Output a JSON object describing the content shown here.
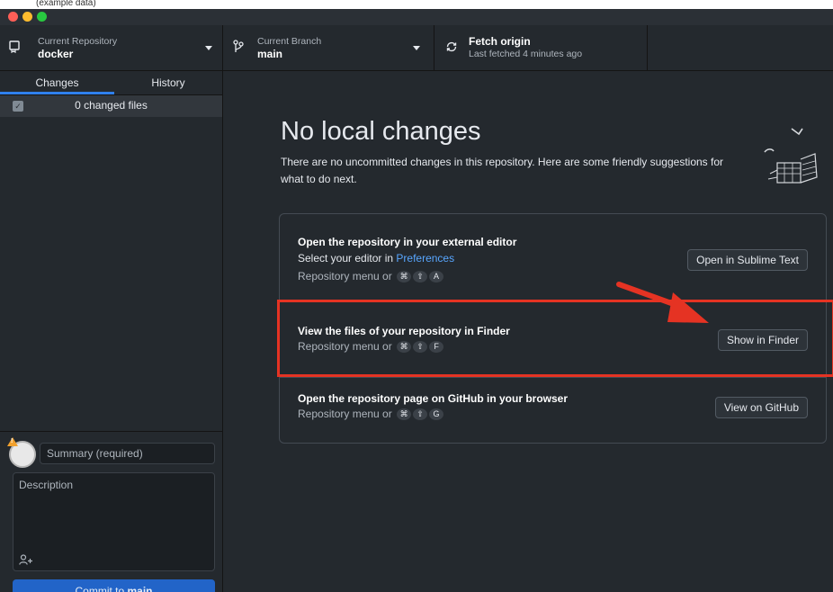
{
  "top_strip_text": "(example data)",
  "toolbar": {
    "repo": {
      "label": "Current Repository",
      "value": "docker"
    },
    "branch": {
      "label": "Current Branch",
      "value": "main"
    },
    "fetch": {
      "label": "Fetch origin",
      "sub": "Last fetched 4 minutes ago"
    }
  },
  "sidebar": {
    "tabs": [
      "Changes",
      "History"
    ],
    "changed_files": "0 changed files",
    "summary_placeholder": "Summary (required)",
    "description_placeholder": "Description",
    "commit_prefix": "Commit to ",
    "commit_branch": "main"
  },
  "main": {
    "title": "No local changes",
    "subtitle": "There are no uncommitted changes in this repository. Here are some friendly suggestions for what to do next.",
    "suggestions": [
      {
        "title": "Open the repository in your external editor",
        "line_prefix": "Select your editor in ",
        "line_link": "Preferences",
        "hint": "Repository menu or",
        "keys": [
          "⌘",
          "⇧",
          "A"
        ],
        "button": "Open in Sublime Text"
      },
      {
        "title": "View the files of your repository in Finder",
        "hint": "Repository menu or",
        "keys": [
          "⌘",
          "⇧",
          "F"
        ],
        "button": "Show in Finder"
      },
      {
        "title": "Open the repository page on GitHub in your browser",
        "hint": "Repository menu or",
        "keys": [
          "⌘",
          "⇧",
          "G"
        ],
        "button": "View on GitHub"
      }
    ]
  },
  "colors": {
    "background": "#24292e",
    "accent": "#2f80ed",
    "commit_button": "#2264c8",
    "annotation": "#e53323",
    "link": "#58a6ff"
  },
  "icons": [
    "repo-icon",
    "branch-icon",
    "sync-icon",
    "caret-down-icon",
    "checkbox-icon",
    "avatar",
    "warning-icon",
    "add-coauthor-icon",
    "illustration",
    "arrow-annotation"
  ]
}
